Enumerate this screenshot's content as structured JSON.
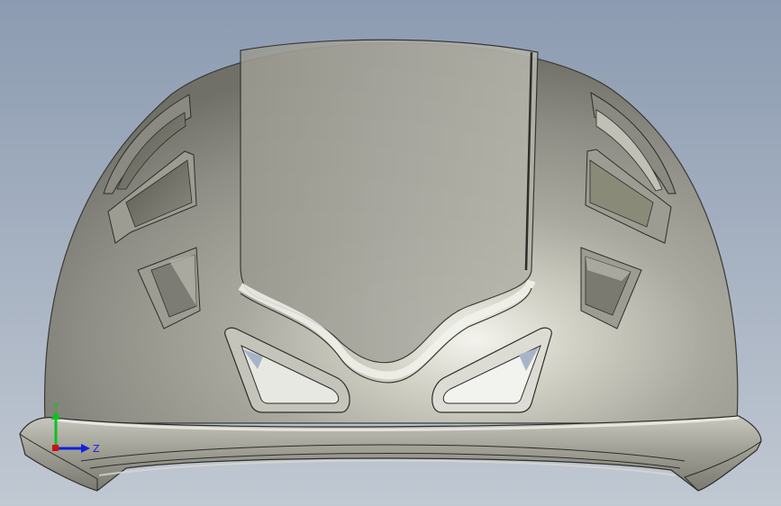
{
  "viewport": {
    "background_top": "#8e9db2",
    "background_bottom": "#bfc8d3",
    "model_color": "#b8b8ae"
  },
  "triad": {
    "y_label": "Y",
    "z_label": "Z",
    "x_color": "#d01010",
    "y_color": "#10c020",
    "z_color": "#1020e0"
  }
}
